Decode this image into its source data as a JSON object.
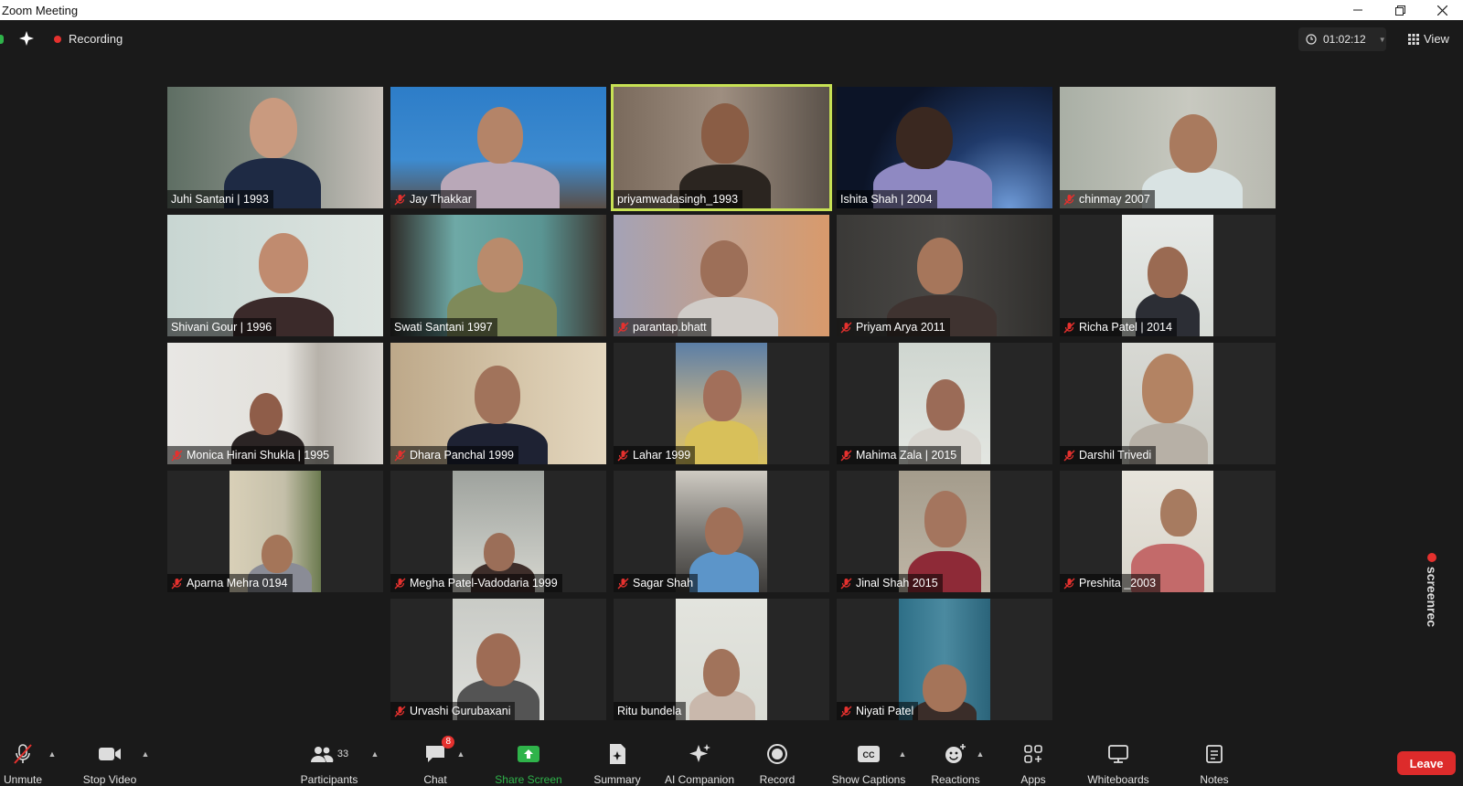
{
  "window": {
    "title": "Zoom Meeting"
  },
  "topbar": {
    "recording_label": "Recording",
    "timer": "01:02:12",
    "view_label": "View"
  },
  "participants": [
    {
      "name": "Juhi Santani | 1993",
      "muted": false,
      "speaking": false
    },
    {
      "name": "Jay Thakkar",
      "muted": true,
      "speaking": false
    },
    {
      "name": "priyamwadasingh_1993",
      "muted": false,
      "speaking": true
    },
    {
      "name": "Ishita Shah | 2004",
      "muted": false,
      "speaking": false
    },
    {
      "name": "chinmay 2007",
      "muted": true,
      "speaking": false
    },
    {
      "name": "Shivani Gour | 1996",
      "muted": false,
      "speaking": false
    },
    {
      "name": "Swati Santani 1997",
      "muted": false,
      "speaking": false
    },
    {
      "name": "parantap.bhatt",
      "muted": true,
      "speaking": false
    },
    {
      "name": "Priyam Arya 2011",
      "muted": true,
      "speaking": false
    },
    {
      "name": "Richa Patel | 2014",
      "muted": true,
      "speaking": false
    },
    {
      "name": "Monica Hirani Shukla | 1995",
      "muted": true,
      "speaking": false
    },
    {
      "name": "Dhara Panchal 1999",
      "muted": true,
      "speaking": false
    },
    {
      "name": "Lahar 1999",
      "muted": true,
      "speaking": false
    },
    {
      "name": "Mahima Zala | 2015",
      "muted": true,
      "speaking": false
    },
    {
      "name": "Darshil Trivedi",
      "muted": true,
      "speaking": false
    },
    {
      "name": "Aparna Mehra 0194",
      "muted": true,
      "speaking": false
    },
    {
      "name": "Megha Patel-Vadodaria 1999",
      "muted": true,
      "speaking": false
    },
    {
      "name": "Sagar Shah",
      "muted": true,
      "speaking": false
    },
    {
      "name": "Jinal Shah 2015",
      "muted": true,
      "speaking": false
    },
    {
      "name": "Preshita _2003",
      "muted": true,
      "speaking": false
    },
    {
      "name": "Urvashi Gurubaxani",
      "muted": true,
      "speaking": false
    },
    {
      "name": "Ritu bundela",
      "muted": false,
      "speaking": false
    },
    {
      "name": "Niyati Patel",
      "muted": true,
      "speaking": false
    }
  ],
  "toolbar": {
    "unmute": "Unmute",
    "stop_video": "Stop Video",
    "participants": "Participants",
    "participants_count": "33",
    "chat": "Chat",
    "chat_badge": "8",
    "share_screen": "Share Screen",
    "summary": "Summary",
    "ai_companion": "AI Companion",
    "record": "Record",
    "show_captions": "Show Captions",
    "reactions": "Reactions",
    "apps": "Apps",
    "whiteboards": "Whiteboards",
    "notes": "Notes",
    "leave": "Leave"
  },
  "watermark": {
    "text": "screenrec"
  },
  "colors": {
    "accent_green": "#2fb34a",
    "speaking_border": "#c7e154",
    "leave_red": "#dd2b2b",
    "record_red": "#e5312e"
  }
}
